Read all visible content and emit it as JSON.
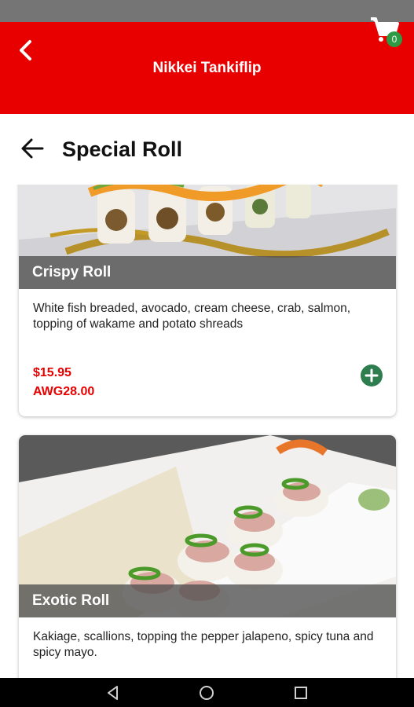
{
  "app": {
    "title": "Nikkei Tankiflip",
    "cart_count": "0"
  },
  "page": {
    "title": "Special Roll"
  },
  "items": [
    {
      "name": "Crispy Roll",
      "description": "White fish breaded, avocado, cream cheese, crab, salmon, topping of wakame and potato shreads",
      "price_usd": "$15.95",
      "price_awg": "AWG28.00"
    },
    {
      "name": "Exotic Roll",
      "description": "Kakiage, scallions, topping the pepper jalapeno, spicy tuna and spicy mayo."
    }
  ],
  "colors": {
    "app_bar": "#e80000",
    "price": "#e80000",
    "add_button": "#2e7d4f",
    "cart_badge": "#2e9a44"
  },
  "icons": {
    "back": "chevron-left-icon",
    "cart": "shopping-cart-icon",
    "page_back": "arrow-left-icon",
    "add": "plus-circle-icon",
    "nav": [
      "nav-back-icon",
      "nav-home-icon",
      "nav-recents-icon"
    ]
  }
}
